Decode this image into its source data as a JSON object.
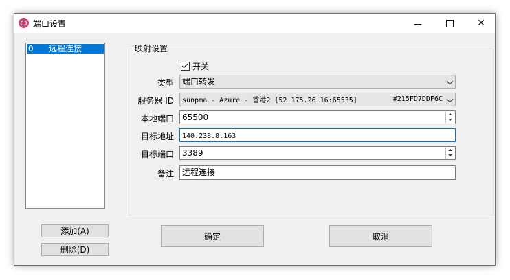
{
  "window": {
    "title": "端口设置"
  },
  "list": {
    "items": [
      {
        "index": "0",
        "name": "远程连接"
      }
    ]
  },
  "buttons": {
    "add": "添加(A)",
    "delete": "删除(D)",
    "ok": "确定",
    "cancel": "取消"
  },
  "group": {
    "title": "映射设置"
  },
  "form": {
    "switch_label": "开关",
    "switch_checked": true,
    "type_label": "类型",
    "type_value": "端口转发",
    "server_label": "服务器 ID",
    "server_value": "sunpma - Azure - 香港2 [52.175.26.16:65535]",
    "server_id": "#215FD7DDF6C",
    "local_port_label": "本地端口",
    "local_port_value": "65500",
    "target_addr_label": "目标地址",
    "target_addr_value": "140.238.8.163",
    "target_port_label": "目标端口",
    "target_port_value": "3389",
    "note_label": "备注",
    "note_value": "远程连接"
  },
  "colors": {
    "selection": "#0078d7",
    "focus_border": "#0078d7",
    "app_icon": "#d0436b"
  }
}
